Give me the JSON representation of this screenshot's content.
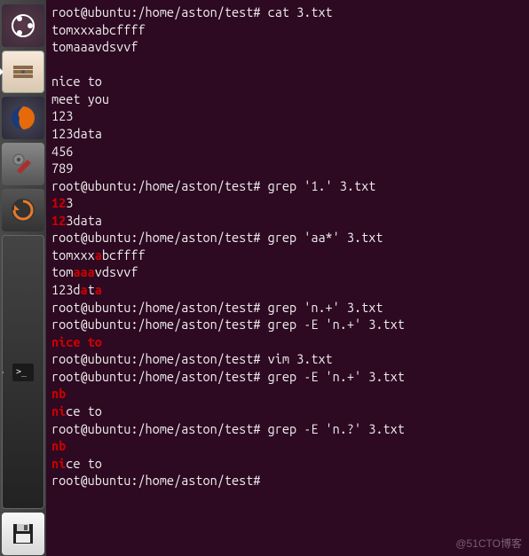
{
  "launcher": {
    "items": [
      {
        "name": "ubuntu-dash",
        "icon": "ubuntu"
      },
      {
        "name": "files",
        "icon": "files",
        "active": true
      },
      {
        "name": "firefox",
        "icon": "firefox"
      },
      {
        "name": "system-settings",
        "icon": "settings"
      },
      {
        "name": "software-updater",
        "icon": "updater"
      },
      {
        "name": "terminal",
        "icon": "terminal",
        "active": true
      },
      {
        "name": "save",
        "icon": "save"
      }
    ]
  },
  "prompt": {
    "user_host": "root@ubuntu",
    "path": "/home/aston/test",
    "sep": "#"
  },
  "terminal": {
    "lines": [
      {
        "type": "cmd",
        "text": "cat 3.txt"
      },
      {
        "type": "out",
        "segments": [
          {
            "t": "tomxxxabcffff"
          }
        ]
      },
      {
        "type": "out",
        "segments": [
          {
            "t": "tomaaavdsvvf"
          }
        ]
      },
      {
        "type": "blank"
      },
      {
        "type": "out",
        "segments": [
          {
            "t": "nice to"
          }
        ]
      },
      {
        "type": "out",
        "segments": [
          {
            "t": "meet you"
          }
        ]
      },
      {
        "type": "out",
        "segments": [
          {
            "t": "123"
          }
        ]
      },
      {
        "type": "out",
        "segments": [
          {
            "t": "123data"
          }
        ]
      },
      {
        "type": "out",
        "segments": [
          {
            "t": "456"
          }
        ]
      },
      {
        "type": "out",
        "segments": [
          {
            "t": "789"
          }
        ]
      },
      {
        "type": "cmd",
        "text": "grep '1.' 3.txt"
      },
      {
        "type": "out",
        "segments": [
          {
            "t": "12",
            "m": true
          },
          {
            "t": "3"
          }
        ]
      },
      {
        "type": "out",
        "segments": [
          {
            "t": "12",
            "m": true
          },
          {
            "t": "3data"
          }
        ]
      },
      {
        "type": "cmd",
        "text": "grep 'aa*' 3.txt"
      },
      {
        "type": "out",
        "segments": [
          {
            "t": "tomxxx"
          },
          {
            "t": "a",
            "m": true
          },
          {
            "t": "bcffff"
          }
        ]
      },
      {
        "type": "out",
        "segments": [
          {
            "t": "tom"
          },
          {
            "t": "aaa",
            "m": true
          },
          {
            "t": "vdsvvf"
          }
        ]
      },
      {
        "type": "out",
        "segments": [
          {
            "t": "123d"
          },
          {
            "t": "a",
            "m": true
          },
          {
            "t": "t"
          },
          {
            "t": "a",
            "m": true
          }
        ]
      },
      {
        "type": "cmd",
        "text": "grep 'n.+' 3.txt"
      },
      {
        "type": "cmd",
        "text": "grep -E 'n.+' 3.txt"
      },
      {
        "type": "out",
        "segments": [
          {
            "t": "nice to",
            "m": true
          }
        ]
      },
      {
        "type": "cmd",
        "text": "vim 3.txt"
      },
      {
        "type": "cmd",
        "text": "grep -E 'n.+' 3.txt"
      },
      {
        "type": "out",
        "segments": [
          {
            "t": "nb",
            "m": true
          }
        ]
      },
      {
        "type": "out",
        "segments": [
          {
            "t": "ni",
            "m": true
          },
          {
            "t": "ce to"
          }
        ]
      },
      {
        "type": "cmd",
        "text": "grep -E 'n.?' 3.txt"
      },
      {
        "type": "out",
        "segments": [
          {
            "t": "nb",
            "m": true
          }
        ]
      },
      {
        "type": "out",
        "segments": [
          {
            "t": "ni",
            "m": true
          },
          {
            "t": "ce to"
          }
        ]
      },
      {
        "type": "cmd",
        "text": ""
      }
    ]
  },
  "watermark": "@51CTO博客"
}
